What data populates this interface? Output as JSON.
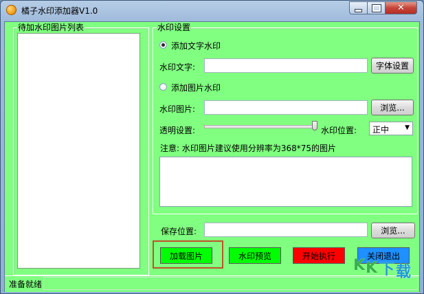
{
  "window": {
    "title": "橘子水印添加器V1.0"
  },
  "left_panel": {
    "legend": "待加水印图片列表"
  },
  "settings": {
    "legend": "水印设置",
    "add_text_radio": "添加文字水印",
    "text_label": "水印文字:",
    "text_value": "",
    "font_button": "字体设置",
    "add_image_radio": "添加图片水印",
    "image_label": "水印图片:",
    "image_value": "",
    "browse_button": "浏览...",
    "opacity_label": "透明设置:",
    "opacity_level": 1.0,
    "position_label": "水印位置:",
    "position_value": "正中",
    "note": "注意: 水印图片建议使用分辨率为368*75的图片"
  },
  "save": {
    "label": "保存位置:",
    "value": "",
    "browse_button": "浏览..."
  },
  "actions": {
    "load": "加载图片",
    "preview": "水印预览",
    "start": "开始执行",
    "exit": "关闭退出"
  },
  "colors": {
    "client_bg": "#80ff80",
    "load_bg": "#00ff00",
    "preview_bg": "#00ff00",
    "start_bg": "#ff0000",
    "exit_bg": "#1e90ff"
  },
  "status": {
    "text": "准备就绪"
  },
  "watermark_logo": "KK下载"
}
